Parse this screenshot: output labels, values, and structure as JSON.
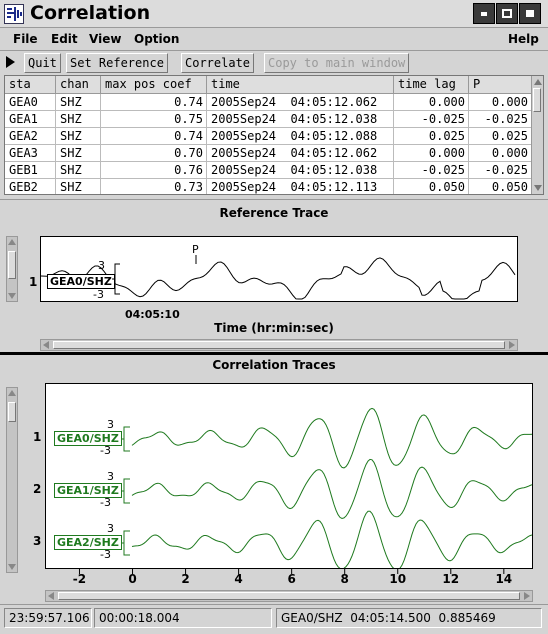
{
  "window": {
    "title": "Correlation"
  },
  "menu": {
    "file": "File",
    "edit": "Edit",
    "view": "View",
    "option": "Option",
    "help": "Help"
  },
  "toolbar": {
    "quit": "Quit",
    "set_reference": "Set Reference",
    "correlate": "Correlate",
    "copy_to_main": "Copy to main window"
  },
  "table": {
    "headers": [
      "sta",
      "chan",
      "max pos coef",
      "time",
      "time lag",
      "P"
    ],
    "rows": [
      [
        "GEA0",
        "SHZ",
        "0.74",
        "2005Sep24  04:05:12.062",
        "0.000",
        "0.000"
      ],
      [
        "GEA1",
        "SHZ",
        "0.75",
        "2005Sep24  04:05:12.038",
        "-0.025",
        "-0.025"
      ],
      [
        "GEA2",
        "SHZ",
        "0.74",
        "2005Sep24  04:05:12.088",
        "0.025",
        "0.025"
      ],
      [
        "GEA3",
        "SHZ",
        "0.70",
        "2005Sep24  04:05:12.062",
        "0.000",
        "0.000"
      ],
      [
        "GEB1",
        "SHZ",
        "0.76",
        "2005Sep24  04:05:12.038",
        "-0.025",
        "-0.025"
      ],
      [
        "GEB2",
        "SHZ",
        "0.73",
        "2005Sep24  04:05:12.113",
        "0.050",
        "0.050"
      ]
    ]
  },
  "reference": {
    "title": "Reference Trace",
    "trace_number": "1",
    "trace_label": "GEA0/SHZ",
    "scale_top": "3",
    "scale_bottom": "-3",
    "phase_label": "P",
    "time_tick": "04:05:10",
    "x_axis_label": "Time (hr:min:sec)"
  },
  "correlation": {
    "title": "Correlation Traces",
    "traces": [
      {
        "number": "1",
        "label": "GEA0/SHZ",
        "scale_top": "3",
        "scale_bottom": "-3"
      },
      {
        "number": "2",
        "label": "GEA1/SHZ",
        "scale_top": "3",
        "scale_bottom": "-3"
      },
      {
        "number": "3",
        "label": "GEA2/SHZ",
        "scale_top": "3",
        "scale_bottom": "-3"
      }
    ],
    "x_ticks": [
      "-2",
      "0",
      "2",
      "4",
      "6",
      "8",
      "10",
      "12",
      "14"
    ]
  },
  "status": {
    "time": "23:59:57.106",
    "duration": "00:00:18.004",
    "cursor_info": "GEA0/SHZ  04:05:14.500  0.885469"
  },
  "colors": {
    "trace_green": "#1f7a1f",
    "reference_black": "#000000"
  }
}
